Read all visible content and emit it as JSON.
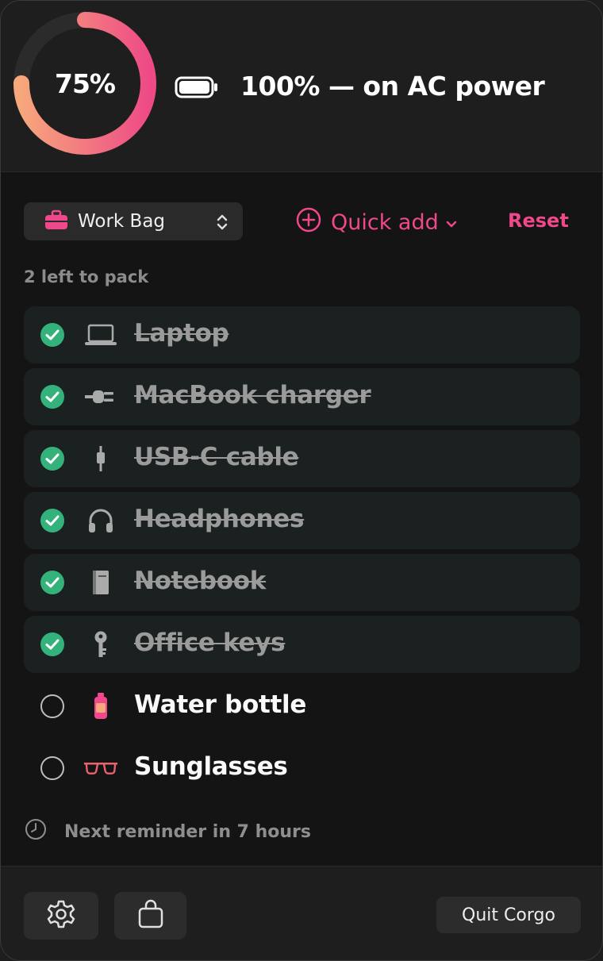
{
  "header": {
    "progress_label": "75%",
    "progress_fraction": 0.75,
    "battery_text": "100% — on AC power"
  },
  "toolbar": {
    "bag_name": "Work Bag",
    "quick_add_label": "Quick add",
    "reset_label": "Reset"
  },
  "summary": {
    "left_to_pack": "2 left to pack"
  },
  "items": [
    {
      "label": "Laptop",
      "packed": true,
      "icon": "laptop-icon"
    },
    {
      "label": "MacBook charger",
      "packed": true,
      "icon": "plug-icon"
    },
    {
      "label": "USB-C cable",
      "packed": true,
      "icon": "cable-icon"
    },
    {
      "label": "Headphones",
      "packed": true,
      "icon": "headphones-icon"
    },
    {
      "label": "Notebook",
      "packed": true,
      "icon": "book-icon"
    },
    {
      "label": "Office keys",
      "packed": true,
      "icon": "key-icon"
    },
    {
      "label": "Water bottle",
      "packed": false,
      "icon": "water-bottle-icon"
    },
    {
      "label": "Sunglasses",
      "packed": false,
      "icon": "sunglasses-icon"
    }
  ],
  "reminder": {
    "text": "Next reminder in 7 hours"
  },
  "footer": {
    "quit_label": "Quit Corgo"
  },
  "colors": {
    "accent": "#f0488a",
    "ring_start": "#f5a07a",
    "ring_end": "#ee4b86",
    "check_green": "#34b27b",
    "done_row_bg": "#1a2120"
  }
}
